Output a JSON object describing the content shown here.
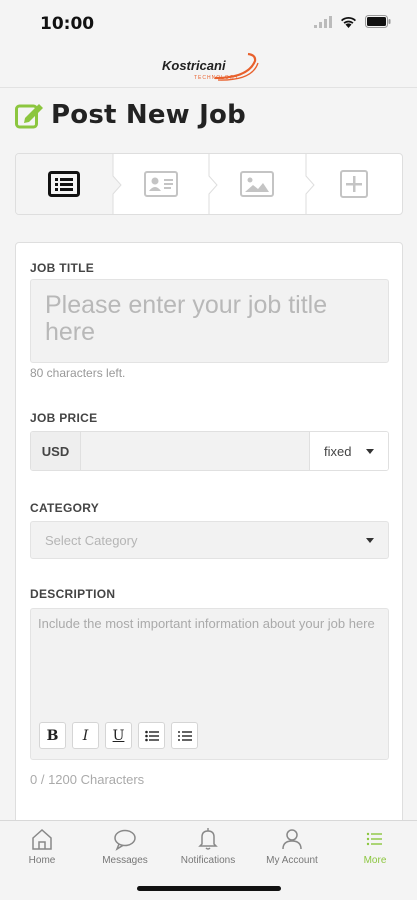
{
  "status": {
    "time": "10:00"
  },
  "header": {
    "logo_text": "Kostricani",
    "logo_subtext": "TECHNOLOGY"
  },
  "page": {
    "title": "Post New Job"
  },
  "steps": [
    {
      "icon": "list-icon",
      "active": true
    },
    {
      "icon": "id-card-icon",
      "active": false
    },
    {
      "icon": "image-icon",
      "active": false
    },
    {
      "icon": "plus-square-icon",
      "active": false
    }
  ],
  "form": {
    "job_title": {
      "label": "JOB TITLE",
      "placeholder": "Please enter your job title here",
      "helper": "80 characters left."
    },
    "job_price": {
      "label": "JOB PRICE",
      "currency": "USD",
      "value": "",
      "type": "fixed"
    },
    "category": {
      "label": "CATEGORY",
      "placeholder": "Select Category"
    },
    "description": {
      "label": "DESCRIPTION",
      "placeholder": "Include the most important information about your job here",
      "toolbar": [
        "B",
        "I",
        "U"
      ],
      "char_count": "0 / 1200 Characters"
    }
  },
  "tabs": [
    {
      "label": "Home",
      "icon": "home-icon",
      "active": false
    },
    {
      "label": "Messages",
      "icon": "chat-bubble-icon",
      "active": false
    },
    {
      "label": "Notifications",
      "icon": "bell-icon",
      "active": false
    },
    {
      "label": "My Account",
      "icon": "user-icon",
      "active": false
    },
    {
      "label": "More",
      "icon": "menu-list-icon",
      "active": true
    }
  ],
  "colors": {
    "accent": "#8cc63f",
    "logo_orange": "#e8602c",
    "background": "#f4f4f4"
  }
}
